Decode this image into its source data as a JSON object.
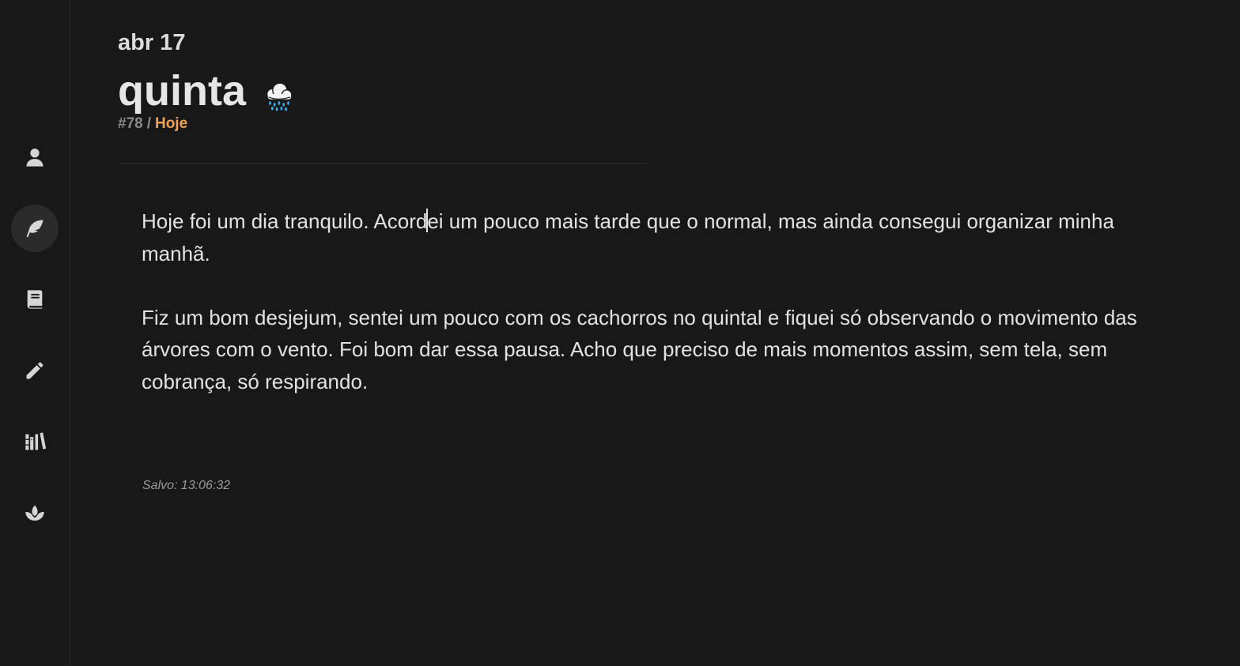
{
  "header": {
    "date": "abr 17",
    "day": "quinta",
    "weather_icon": "rain-cloud-icon",
    "entry_number": "#78",
    "separator": "/",
    "breadcrumb_today": "Hoje"
  },
  "sidebar": {
    "items": [
      {
        "icon": "user-icon",
        "active": false
      },
      {
        "icon": "feather-icon",
        "active": true
      },
      {
        "icon": "book-icon",
        "active": false
      },
      {
        "icon": "pencil-icon",
        "active": false
      },
      {
        "icon": "library-icon",
        "active": false
      },
      {
        "icon": "lotus-icon",
        "active": false
      }
    ]
  },
  "entry": {
    "p1_before_caret": "Hoje foi um dia tranquilo. Acord",
    "p1_after_caret": "ei um pouco mais tarde que o normal, mas ainda consegui organizar minha manhã.",
    "p2": "Fiz um bom desjejum, sentei um pouco com os cachorros no quintal e fiquei só observando o movimento das árvores com o vento. Foi bom dar essa pausa. Acho que preciso de mais momentos assim, sem tela, sem cobrança, só respirando."
  },
  "status": {
    "saved": "Salvo: 13:06:32"
  },
  "colors": {
    "background": "#181818",
    "accent": "#f0a45a",
    "text": "#e2e2e2",
    "muted": "#8a8a8a"
  }
}
